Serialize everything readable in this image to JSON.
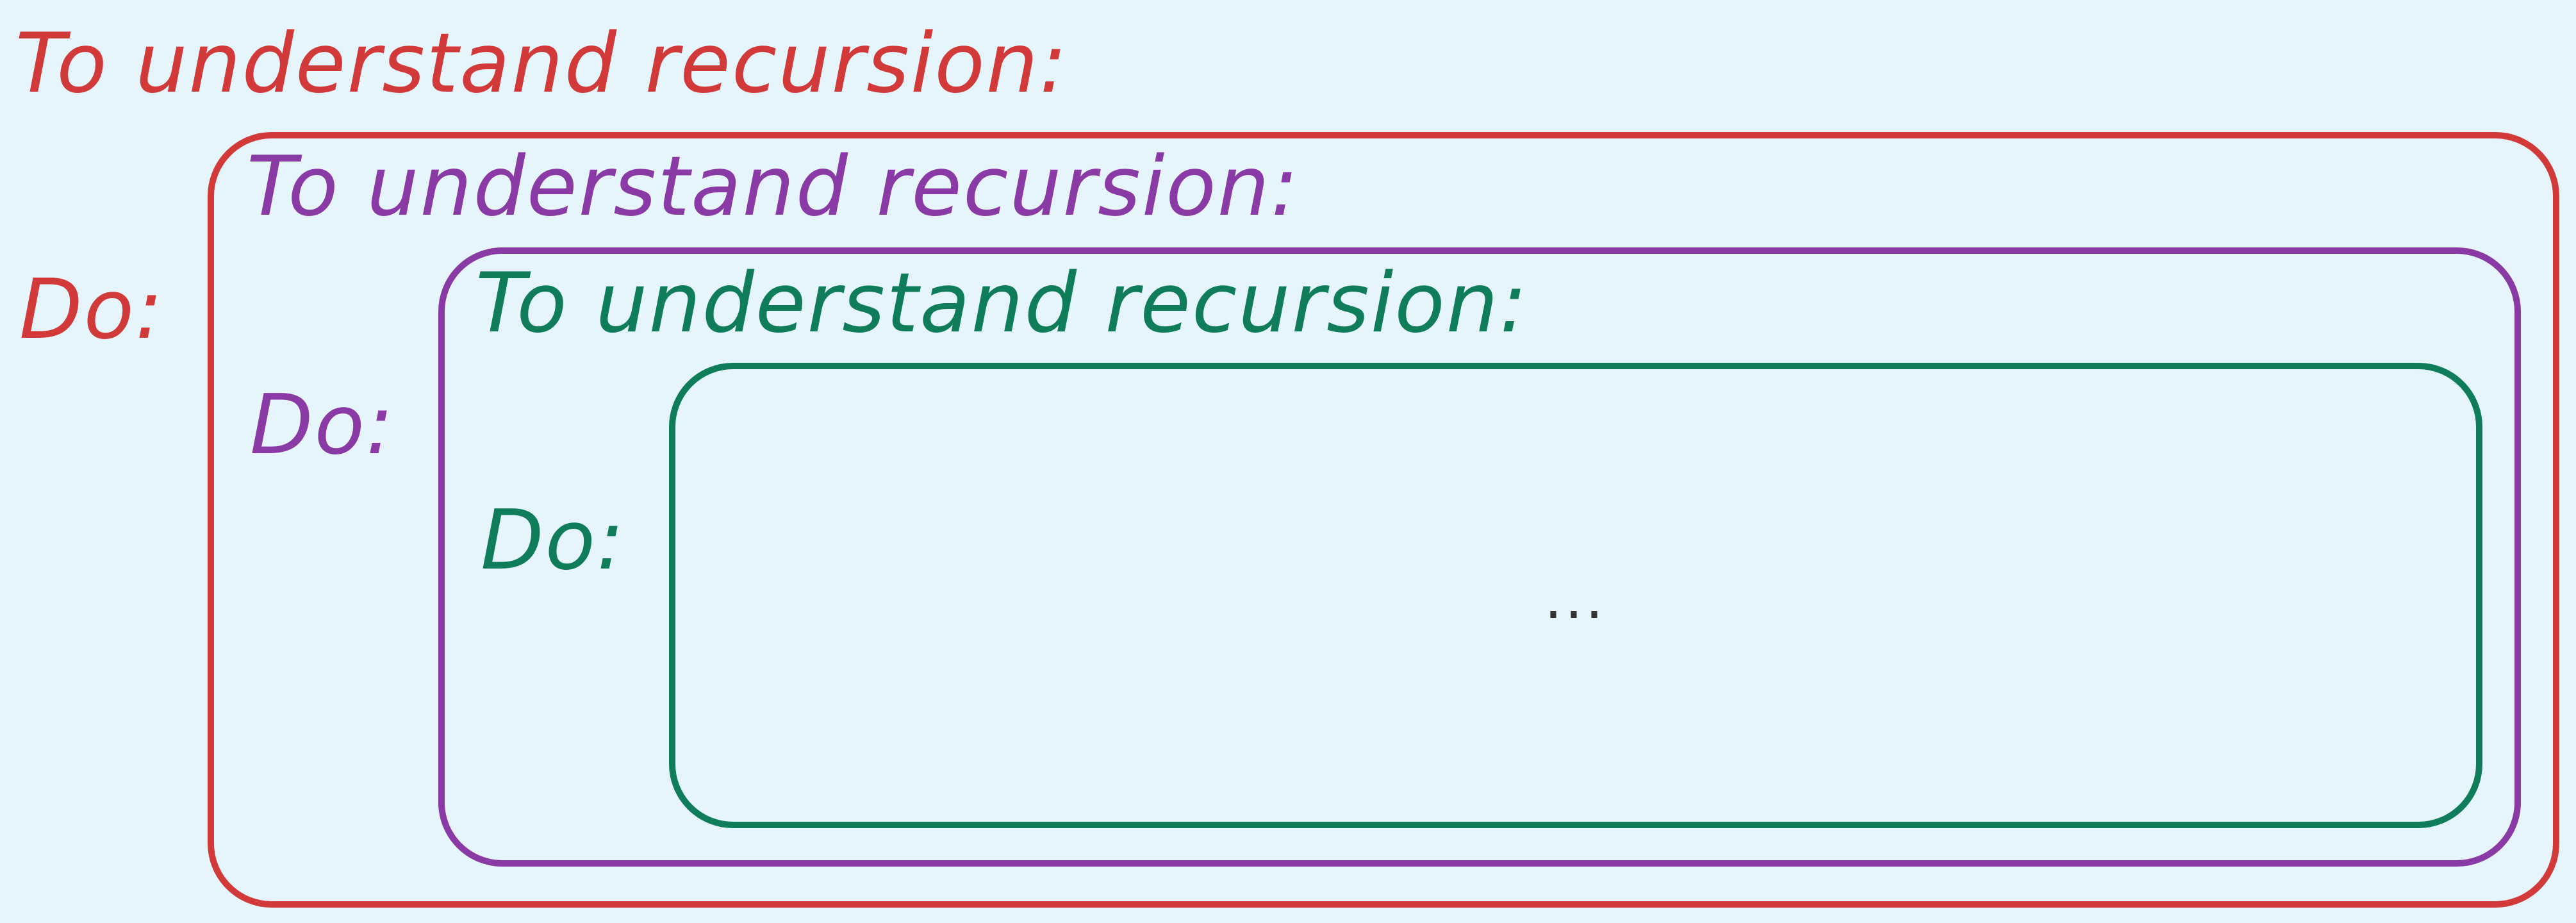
{
  "colors": {
    "background": "#e6f4fc",
    "level1": "#d23a3a",
    "level2": "#8a3aa4",
    "level3": "#0f7d5a",
    "ellipsis": "#333333"
  },
  "levels": [
    {
      "heading": "To understand recursion:",
      "do_label": "Do:",
      "color": "#d23a3a"
    },
    {
      "heading": "To understand recursion:",
      "do_label": "Do:",
      "color": "#8a3aa4"
    },
    {
      "heading": "To understand recursion:",
      "do_label": "Do:",
      "color": "#0f7d5a"
    }
  ],
  "inner_content": "..."
}
